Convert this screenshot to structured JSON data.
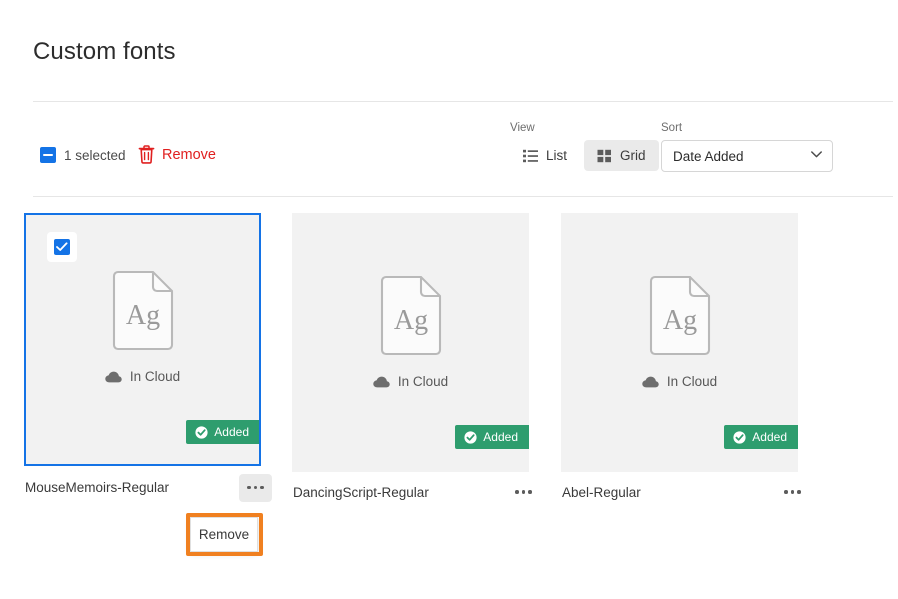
{
  "page": {
    "title": "Custom fonts"
  },
  "toolbar": {
    "selection": {
      "checkbox_icon": "checkbox-indeterminate-icon",
      "label": "1 selected"
    },
    "remove": {
      "icon": "trash-icon",
      "label": "Remove",
      "color": "#e02020"
    },
    "view": {
      "label": "View",
      "options": [
        {
          "id": "list",
          "label": "List",
          "icon": "list-view-icon",
          "active": false
        },
        {
          "id": "grid",
          "label": "Grid",
          "icon": "grid-view-icon",
          "active": true
        }
      ]
    },
    "sort": {
      "label": "Sort",
      "value": "Date Added",
      "chevron_icon": "chevron-down-icon"
    }
  },
  "cards": [
    {
      "name": "MouseMemoirs-Regular",
      "selected": true,
      "checkbox_icon": "checkbox-checked-icon",
      "preview_glyphs": "Ag",
      "status": {
        "icon": "cloud-icon",
        "label": "In Cloud"
      },
      "badge": {
        "icon": "check-circle-icon",
        "label": "Added",
        "color": "#2e9d6e"
      },
      "more_icon": "more-options-icon",
      "more_active": true
    },
    {
      "name": "DancingScript-Regular",
      "selected": false,
      "preview_glyphs": "Ag",
      "status": {
        "icon": "cloud-icon",
        "label": "In Cloud"
      },
      "badge": {
        "icon": "check-circle-icon",
        "label": "Added",
        "color": "#2e9d6e"
      },
      "more_icon": "more-options-icon",
      "more_active": false
    },
    {
      "name": "Abel-Regular",
      "selected": false,
      "preview_glyphs": "Ag",
      "status": {
        "icon": "cloud-icon",
        "label": "In Cloud"
      },
      "badge": {
        "icon": "check-circle-icon",
        "label": "Added",
        "color": "#2e9d6e"
      },
      "more_icon": "more-options-icon",
      "more_active": false
    }
  ],
  "context_menu": {
    "items": [
      {
        "label": "Remove"
      }
    ],
    "highlight_color": "#f08020"
  }
}
